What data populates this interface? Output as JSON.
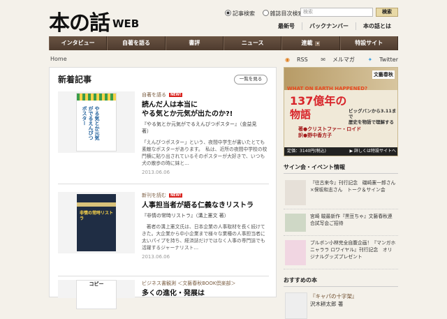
{
  "header": {
    "logo_text": "本の話",
    "logo_suffix": "WEB",
    "search_option_1": "記事検索",
    "search_option_2": "雑誌目次検索",
    "search_placeholder": "検索",
    "search_button": "検索",
    "links": [
      "最新号",
      "バックナンバー",
      "本の話とは"
    ]
  },
  "nav": {
    "items": [
      "インタビュー",
      "自著を語る",
      "書評",
      "ニュース",
      "連載",
      "特設サイト"
    ],
    "dropdown_glyph": "▾"
  },
  "breadcrumb": "Home",
  "feeds": {
    "rss": "RSS",
    "mail": "メルマガ",
    "twitter": "Twitter"
  },
  "main": {
    "heading": "新着記事",
    "more_button": "一覧を見る",
    "new_badge": "NEW!",
    "articles": [
      {
        "category": "自著を語る",
        "title": "読んだ人は本当に\nやる気とか元気が出たのか?!",
        "sub": "『やる気とか元気がでるえんぴつポスター』（金益見\n著）",
        "excerpt": "「えんぴつポスター」という、夜間中学生が書いたとても素敵なポスターがあります。　私は、近所の夜間中学校の校門横に貼り出されているそのポスターが大好きで、いつも犬の散歩の時に妹と…",
        "date": "2013.06.06",
        "cover_text": "やる気とか元気がでるえんぴつポスター"
      },
      {
        "category": "新刊を読む",
        "title": "人事担当者が語る仁義なきリストラ",
        "sub": "『非情の常時リストラ』（溝上憲文 著）",
        "excerpt": "　著者の溝上憲文氏は、日本企業の人事取材を長く続けてきた。大企業から中小企業まで様々な業種の人事担当者に太いパイプを持ち、経済誌だけではなく人事の専門誌でも活躍するジャーナリスト…",
        "date": "2013.06.06",
        "cover_text": "非情の常時リストラ"
      },
      {
        "category": "ビジネス書観測 ＜文藝春秋BOOK倶楽部＞",
        "title": "多くの進化・発展は",
        "cover_text": "コピー"
      }
    ]
  },
  "side": {
    "ad": {
      "publisher": "文藝春秋",
      "headline_en": "WHAT ON EARTH HAPPENED?",
      "headline_big": "137億年の",
      "headline_mono": "物語",
      "aside": "ビッグバンから3.11まで\n歴史を物語で理解する",
      "author": "著●クリストファー・ロイド\n訳●野中香方子",
      "price": "定価：3140円(税込)",
      "detail": "▶ 詳しくは特設サイトへ"
    },
    "events_heading": "サイン会・イベント情報",
    "events": [
      "『往古来今』刊行記念　磯崎憲一郎さん×保坂和志さん　トーク＆サイン会",
      "宮崎 駿最新作『黒豆ちゃ』文藝春秋連合試写会ご招待",
      "ブルボン小林完全自腹企画！『マンガホニャララ ロワイヤル』刊行記念　オリジナルグッズプレゼント"
    ],
    "recommend_heading": "おすすめの本",
    "recommend": [
      {
        "title": "『キャパの十字架』",
        "author": "沢木耕太郎 著"
      }
    ]
  }
}
